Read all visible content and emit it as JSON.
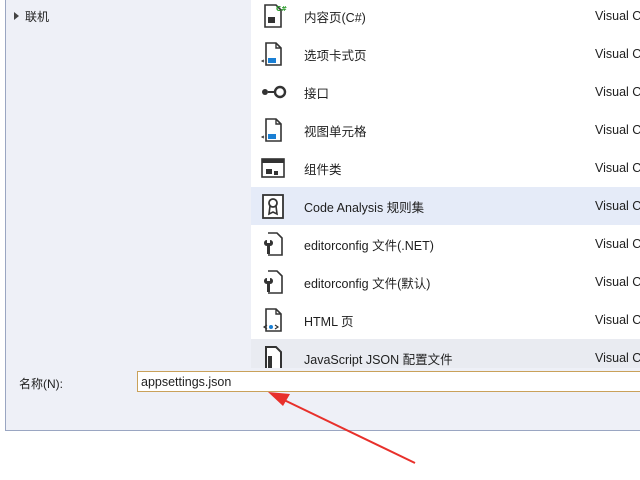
{
  "sidebar": {
    "items": [
      {
        "label": "联机"
      }
    ]
  },
  "templates": [
    {
      "name": "内容页(C#)",
      "lang": "Visual C#",
      "icon": "content-page-icon"
    },
    {
      "name": "选项卡式页",
      "lang": "Visual C#",
      "icon": "tabbed-page-icon"
    },
    {
      "name": "接口",
      "lang": "Visual C#",
      "icon": "interface-icon"
    },
    {
      "name": "视图单元格",
      "lang": "Visual C#",
      "icon": "view-cell-icon"
    },
    {
      "name": "组件类",
      "lang": "Visual C#",
      "icon": "component-class-icon"
    },
    {
      "name": "Code Analysis 规则集",
      "lang": "Visual C#",
      "icon": "ruleset-icon",
      "selected": true
    },
    {
      "name": "editorconfig 文件(.NET)",
      "lang": "Visual C#",
      "icon": "editorconfig-icon"
    },
    {
      "name": "editorconfig 文件(默认)",
      "lang": "Visual C#",
      "icon": "editorconfig-icon"
    },
    {
      "name": "HTML 页",
      "lang": "Visual C#",
      "icon": "html-page-icon"
    },
    {
      "name": "JavaScript JSON 配置文件",
      "lang": "Visual C#",
      "icon": "json-config-icon"
    }
  ],
  "name_field": {
    "label": "名称(N):",
    "value": "appsettings.json"
  },
  "colors": {
    "selected_row": "#e5ebf8",
    "annotation_arrow": "#e8302b",
    "input_border": "#c9a15a"
  }
}
